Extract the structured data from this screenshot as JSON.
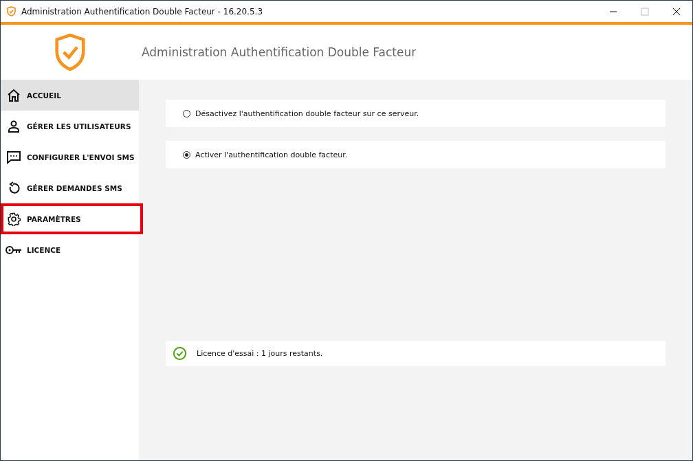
{
  "window": {
    "title": "Administration Authentification Double Facteur - 16.20.5.3"
  },
  "header": {
    "title": "Administration Authentification Double Facteur"
  },
  "sidebar": {
    "items": [
      {
        "label": "ACCUEIL",
        "kind": "home",
        "selected": true,
        "highlighted": false
      },
      {
        "label": "GÉRER LES UTILISATEURS",
        "kind": "user",
        "selected": false,
        "highlighted": false
      },
      {
        "label": "CONFIGURER L'ENVOI SMS",
        "kind": "chat",
        "selected": false,
        "highlighted": false
      },
      {
        "label": "GÉRER DEMANDES SMS",
        "kind": "undo",
        "selected": false,
        "highlighted": false
      },
      {
        "label": "PARAMÈTRES",
        "kind": "gear",
        "selected": false,
        "highlighted": true
      },
      {
        "label": "LICENCE",
        "kind": "key",
        "selected": false,
        "highlighted": false
      }
    ]
  },
  "options": [
    {
      "label": "Désactivez l'authentification double facteur sur ce serveur.",
      "selected": false
    },
    {
      "label": "Activer l'authentification double facteur.",
      "selected": true
    }
  ],
  "license_status": {
    "text": "Licence d'essai : 1 jours restants."
  }
}
